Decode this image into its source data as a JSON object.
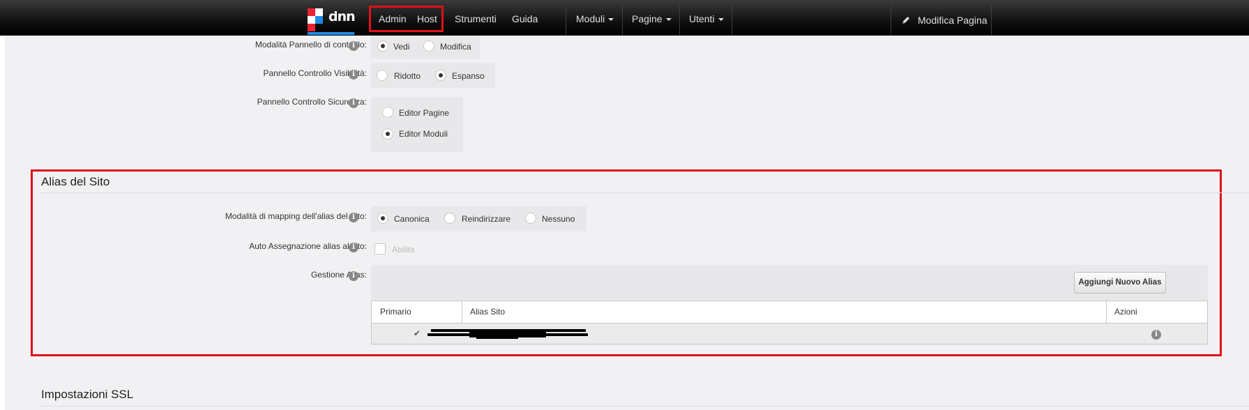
{
  "topbar": {
    "logo_text": "dnn",
    "nav": [
      {
        "label": "Admin"
      },
      {
        "label": "Host"
      },
      {
        "label": "Strumenti"
      },
      {
        "label": "Guida"
      }
    ],
    "menus": [
      {
        "label": "Moduli"
      },
      {
        "label": "Pagine"
      },
      {
        "label": "Utenti"
      }
    ],
    "edit_label": "Modifica Pagina"
  },
  "control_panel": {
    "mode_label": "Modalità Pannello di controllo:",
    "mode_options": [
      {
        "label": "Vedi",
        "selected": true
      },
      {
        "label": "Modifica",
        "selected": false
      }
    ],
    "visibility_label": "Pannello Controllo Visibilità:",
    "visibility_options": [
      {
        "label": "Ridotto",
        "selected": false
      },
      {
        "label": "Espanso",
        "selected": true
      }
    ],
    "security_label": "Pannello Controllo Sicurezza:",
    "security_options": [
      {
        "label": "Editor Pagine",
        "selected": false
      },
      {
        "label": "Editor Moduli",
        "selected": true
      }
    ]
  },
  "site_alias": {
    "title": "Alias del Sito",
    "mapping_label": "Modalità di mapping dell'alias del Sito:",
    "mapping_options": [
      {
        "label": "Canonica",
        "selected": true
      },
      {
        "label": "Reindirizzare",
        "selected": false
      },
      {
        "label": "Nessuno",
        "selected": false
      }
    ],
    "auto_label": "Auto Assegnazione alias al sito:",
    "auto_checkbox_label": "Abilita",
    "manage_label": "Gestione Alias:",
    "add_button": "Aggiungi Nuovo Alias",
    "table": {
      "headers": [
        "Primario",
        "Alias Sito",
        "Azioni"
      ],
      "rows": [
        {
          "primary": "✔",
          "alias": ""
        }
      ]
    }
  },
  "ssl": {
    "title": "Impostazioni SSL"
  },
  "icons": {
    "info": "i"
  },
  "colors": {
    "highlight": "#e0101a",
    "logo_accent": "#1f8ce6"
  }
}
